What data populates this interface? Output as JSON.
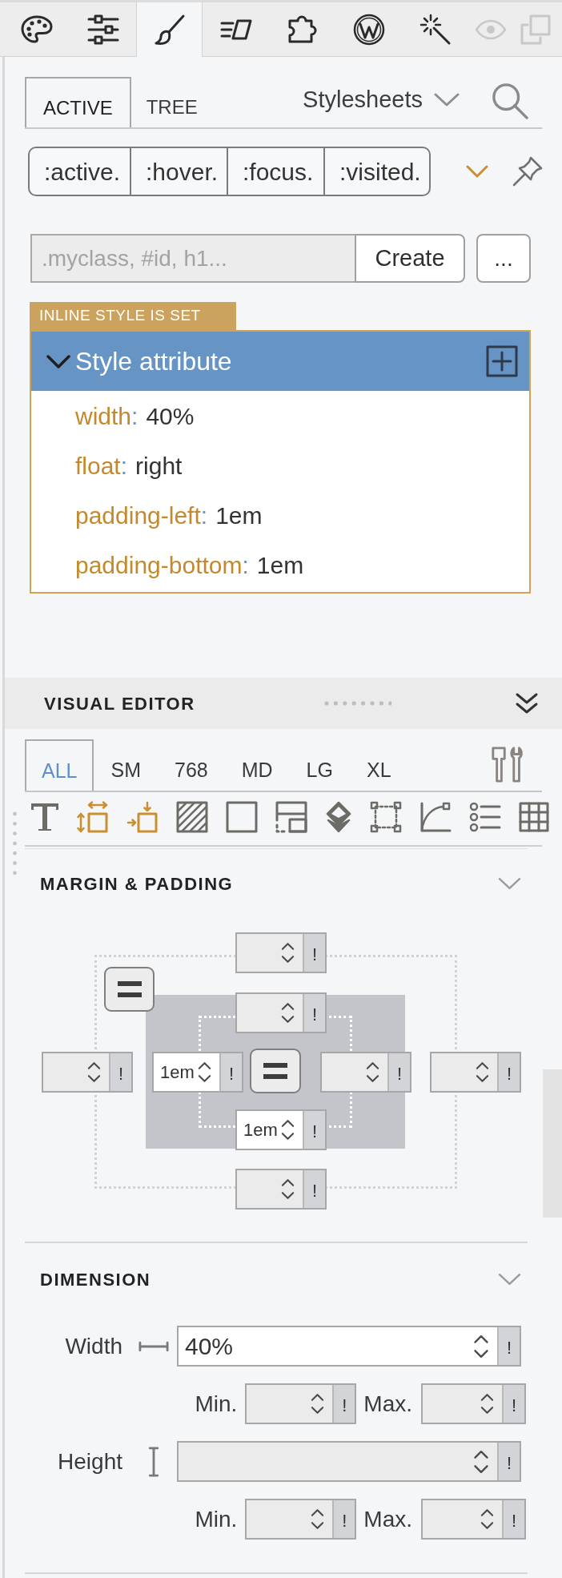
{
  "toolbar": {
    "tabs": [
      {
        "selected": false,
        "disabled": false
      },
      {
        "selected": false,
        "disabled": false
      },
      {
        "selected": true,
        "disabled": false
      },
      {
        "selected": false,
        "disabled": false
      },
      {
        "selected": false,
        "disabled": false
      },
      {
        "selected": false,
        "disabled": false
      },
      {
        "selected": false,
        "disabled": false
      },
      {
        "selected": false,
        "disabled": true
      },
      {
        "selected": false,
        "disabled": true
      }
    ]
  },
  "panel_tabs": [
    {
      "label": "ACTIVE",
      "selected": true
    },
    {
      "label": "TREE",
      "selected": false
    }
  ],
  "stylesheets_dropdown": {
    "label": "Stylesheets"
  },
  "pseudo_classes": [
    {
      "label": ":active.",
      "selected": false
    },
    {
      "label": ":hover.",
      "selected": false
    },
    {
      "label": ":focus.",
      "selected": false
    },
    {
      "label": ":visited.",
      "selected": false
    }
  ],
  "selector_input": {
    "placeholder": ".myclass, #id, h1..."
  },
  "create_button": {
    "label": "Create"
  },
  "more_button": {
    "label": "..."
  },
  "inline_style": {
    "badge": "INLINE STYLE IS SET",
    "title": "Style attribute",
    "expanded": true,
    "properties": [
      {
        "name": "width",
        "separator": ":",
        "value": "40%"
      },
      {
        "name": "float",
        "separator": ":",
        "value": "right"
      },
      {
        "name": "padding-left",
        "separator": ":",
        "value": "1em"
      },
      {
        "name": "padding-bottom",
        "separator": ":",
        "value": "1em"
      }
    ]
  },
  "visual_editor": {
    "title": "VISUAL EDITOR",
    "breakpoints": [
      {
        "label": "ALL",
        "selected": true
      },
      {
        "label": "SM",
        "selected": false
      },
      {
        "label": "768",
        "selected": false
      },
      {
        "label": "MD",
        "selected": false
      },
      {
        "label": "LG",
        "selected": false
      },
      {
        "label": "XL",
        "selected": false
      }
    ],
    "property_groups": [
      {
        "active": false
      },
      {
        "active": true
      },
      {
        "active": true
      },
      {
        "active": false
      },
      {
        "active": false
      },
      {
        "active": false
      },
      {
        "active": false
      },
      {
        "active": false
      },
      {
        "active": false
      },
      {
        "active": false
      },
      {
        "active": false
      }
    ],
    "margin_padding": {
      "title": "MARGIN & PADDING",
      "margin": {
        "top": {
          "important_flag": "!"
        },
        "left": {
          "important_flag": "!"
        },
        "right": {
          "important_flag": "!"
        },
        "bottom": {
          "important_flag": "!"
        }
      },
      "padding": {
        "top": {
          "important_flag": "!"
        },
        "left": {
          "value": "1em",
          "important_flag": "!"
        },
        "right": {
          "important_flag": "!"
        },
        "bottom": {
          "value": "1em",
          "important_flag": "!"
        }
      }
    },
    "dimension": {
      "title": "DIMENSION",
      "rows": [
        {
          "kind": "horizontal",
          "label": "Width",
          "field": {
            "value": "40%",
            "important_flag": "!"
          },
          "min": {
            "label": "Min.",
            "important_flag": "!"
          },
          "max": {
            "label": "Max.",
            "important_flag": "!"
          }
        },
        {
          "kind": "vertical",
          "label": "Height",
          "field": {
            "important_flag": "!"
          },
          "min": {
            "label": "Min.",
            "important_flag": "!"
          },
          "max": {
            "label": "Max.",
            "important_flag": "!"
          }
        }
      ]
    }
  }
}
